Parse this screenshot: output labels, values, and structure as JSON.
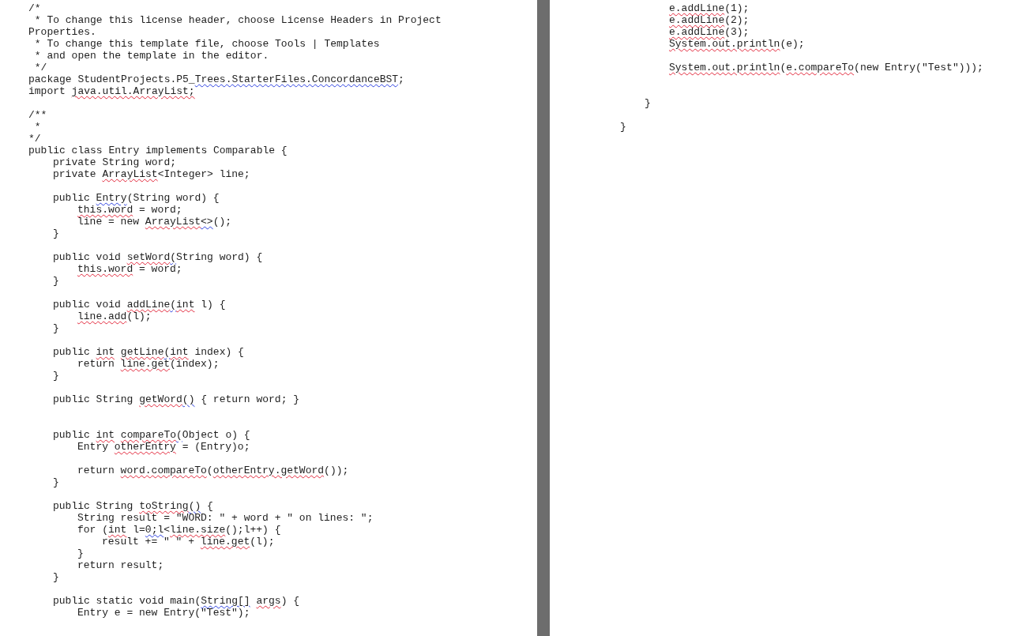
{
  "pages": [
    {
      "lines": [
        {
          "kind": "code",
          "segments": [
            {
              "text": "/*"
            }
          ]
        },
        {
          "kind": "code",
          "segments": [
            {
              "text": " * To change this license header, choose License Headers in Project"
            }
          ]
        },
        {
          "kind": "code",
          "segments": [
            {
              "text": "Properties."
            }
          ]
        },
        {
          "kind": "code",
          "segments": [
            {
              "text": " * To change this template file, choose Tools | Templates"
            }
          ]
        },
        {
          "kind": "code",
          "segments": [
            {
              "text": " * and open the template in the editor."
            }
          ]
        },
        {
          "kind": "code",
          "segments": [
            {
              "text": " */"
            }
          ]
        },
        {
          "kind": "code",
          "segments": [
            {
              "text": "package StudentProjects.P5_"
            },
            {
              "text": "Trees.StarterFiles.ConcordanceBST",
              "grammar_error": true
            },
            {
              "text": ";"
            }
          ]
        },
        {
          "kind": "code",
          "segments": [
            {
              "text": "import "
            },
            {
              "text": "java.util.ArrayList;",
              "spelling_error": true
            }
          ]
        },
        {
          "kind": "blank"
        },
        {
          "kind": "code",
          "segments": [
            {
              "text": "/**"
            }
          ]
        },
        {
          "kind": "code",
          "segments": [
            {
              "text": " *"
            }
          ]
        },
        {
          "kind": "code",
          "segments": [
            {
              "text": "*/"
            }
          ]
        },
        {
          "kind": "code",
          "segments": [
            {
              "text": "public class Entry implements Comparable {"
            }
          ],
          "children": [
            {
              "kind": "code",
              "segments": [
                {
                  "text": "private String word;"
                }
              ]
            },
            {
              "kind": "code",
              "segments": [
                {
                  "text": "private "
                },
                {
                  "text": "ArrayList",
                  "spelling_error": true
                },
                {
                  "text": "<Integer> line;"
                }
              ]
            },
            {
              "kind": "blank"
            },
            {
              "kind": "code",
              "segments": [
                {
                  "text": "public "
                },
                {
                  "text": "Entry",
                  "grammar_error": true
                },
                {
                  "text": "(String word) {"
                }
              ],
              "children": [
                {
                  "kind": "code",
                  "segments": [
                    {
                      "text": "this.word",
                      "spelling_error": true
                    },
                    {
                      "text": " = word;"
                    }
                  ]
                },
                {
                  "kind": "code",
                  "segments": [
                    {
                      "text": "line = new "
                    },
                    {
                      "text": "ArrayList",
                      "spelling_error": true
                    },
                    {
                      "text": "<>",
                      "grammar_error": true
                    },
                    {
                      "text": "();"
                    }
                  ]
                }
              ]
            },
            {
              "kind": "code",
              "segments": [
                {
                  "text": "}"
                }
              ]
            },
            {
              "kind": "blank"
            },
            {
              "kind": "code",
              "segments": [
                {
                  "text": "public void "
                },
                {
                  "text": "setWord",
                  "spelling_error": true
                },
                {
                  "text": "(",
                  "grammar_error": true
                },
                {
                  "text": "String word) {"
                }
              ],
              "children": [
                {
                  "kind": "code",
                  "segments": [
                    {
                      "text": "this.word",
                      "spelling_error": true
                    },
                    {
                      "text": " = word;"
                    }
                  ]
                }
              ]
            },
            {
              "kind": "code",
              "segments": [
                {
                  "text": "}"
                }
              ]
            },
            {
              "kind": "blank"
            },
            {
              "kind": "code",
              "segments": [
                {
                  "text": "public void "
                },
                {
                  "text": "addLine",
                  "spelling_error": true
                },
                {
                  "text": "(",
                  "grammar_error": true
                },
                {
                  "text": "int",
                  "spelling_error": true
                },
                {
                  "text": " l) {"
                }
              ],
              "children": [
                {
                  "kind": "code",
                  "segments": [
                    {
                      "text": "line.add",
                      "spelling_error": true
                    },
                    {
                      "text": "(l);"
                    }
                  ]
                }
              ]
            },
            {
              "kind": "code",
              "segments": [
                {
                  "text": "}"
                }
              ]
            },
            {
              "kind": "blank"
            },
            {
              "kind": "code",
              "segments": [
                {
                  "text": "public "
                },
                {
                  "text": "int",
                  "spelling_error": true
                },
                {
                  "text": " getLine",
                  "spelling_error": true
                },
                {
                  "text": "(",
                  "grammar_error": true
                },
                {
                  "text": "int",
                  "spelling_error": true
                },
                {
                  "text": " index) {"
                }
              ],
              "children": [
                {
                  "kind": "code",
                  "segments": [
                    {
                      "text": "return "
                    },
                    {
                      "text": "line.get",
                      "spelling_error": true
                    },
                    {
                      "text": "(index);"
                    }
                  ]
                }
              ]
            },
            {
              "kind": "code",
              "segments": [
                {
                  "text": "}"
                }
              ]
            },
            {
              "kind": "blank"
            },
            {
              "kind": "code",
              "segments": [
                {
                  "text": "public String "
                },
                {
                  "text": "getWord",
                  "spelling_error": true
                },
                {
                  "text": "()",
                  "grammar_error": true
                },
                {
                  "text": " { return word; }"
                }
              ]
            },
            {
              "kind": "blank"
            },
            {
              "kind": "blank"
            },
            {
              "kind": "code",
              "segments": [
                {
                  "text": "public "
                },
                {
                  "text": "int",
                  "spelling_error": true
                },
                {
                  "text": " compareTo",
                  "spelling_error": true
                },
                {
                  "text": "(",
                  "grammar_error": true
                },
                {
                  "text": "Object o) {"
                }
              ],
              "children": [
                {
                  "kind": "code",
                  "segments": [
                    {
                      "text": "Entry "
                    },
                    {
                      "text": "otherEntry",
                      "spelling_error": true
                    },
                    {
                      "text": " = (Entry)o;"
                    }
                  ]
                },
                {
                  "kind": "blank"
                },
                {
                  "kind": "code",
                  "segments": [
                    {
                      "text": "return "
                    },
                    {
                      "text": "word.compareTo",
                      "spelling_error": true
                    },
                    {
                      "text": "("
                    },
                    {
                      "text": "otherEntry.getWord",
                      "spelling_error": true
                    },
                    {
                      "text": "());"
                    }
                  ]
                }
              ]
            },
            {
              "kind": "code",
              "segments": [
                {
                  "text": "}"
                }
              ]
            },
            {
              "kind": "blank"
            },
            {
              "kind": "code",
              "segments": [
                {
                  "text": "public String "
                },
                {
                  "text": "toString",
                  "spelling_error": true
                },
                {
                  "text": "()",
                  "grammar_error": true
                },
                {
                  "text": " {"
                }
              ],
              "children": [
                {
                  "kind": "code",
                  "segments": [
                    {
                      "text": "String result = \"WORD: \" + word + \" on lines: \";"
                    }
                  ]
                },
                {
                  "kind": "code",
                  "segments": [
                    {
                      "text": "for ("
                    },
                    {
                      "text": "int",
                      "spelling_error": true
                    },
                    {
                      "text": " l="
                    },
                    {
                      "text": "0;l",
                      "grammar_error": true
                    },
                    {
                      "text": "<"
                    },
                    {
                      "text": "line.size",
                      "spelling_error": true
                    },
                    {
                      "text": "();l++) {"
                    }
                  ],
                  "children": [
                    {
                      "kind": "code",
                      "segments": [
                        {
                          "text": "result += \" \" + "
                        },
                        {
                          "text": "line.get",
                          "spelling_error": true
                        },
                        {
                          "text": "(l);"
                        }
                      ]
                    }
                  ]
                },
                {
                  "kind": "code",
                  "segments": [
                    {
                      "text": "}"
                    }
                  ]
                },
                {
                  "kind": "code",
                  "segments": [
                    {
                      "text": "return result;"
                    }
                  ]
                }
              ]
            },
            {
              "kind": "code",
              "segments": [
                {
                  "text": "}"
                }
              ]
            },
            {
              "kind": "blank"
            },
            {
              "kind": "code",
              "segments": [
                {
                  "text": "public static void main("
                },
                {
                  "text": "String[]",
                  "grammar_error": true
                },
                {
                  "text": " args",
                  "spelling_error": true
                },
                {
                  "text": ") {"
                }
              ],
              "children": [
                {
                  "kind": "code",
                  "segments": [
                    {
                      "text": "Entry e = new Entry(\"Test\");"
                    }
                  ]
                }
              ]
            }
          ]
        }
      ]
    },
    {
      "lines": [
        {
          "kind": "continued",
          "children": [
            {
              "kind": "continued",
              "children": [
                {
                  "kind": "code",
                  "segments": [
                    {
                      "text": "e.addLine",
                      "spelling_error": true
                    },
                    {
                      "text": "(1);"
                    }
                  ]
                },
                {
                  "kind": "code",
                  "segments": [
                    {
                      "text": "e.addLine",
                      "spelling_error": true
                    },
                    {
                      "text": "(2);"
                    }
                  ]
                },
                {
                  "kind": "code",
                  "segments": [
                    {
                      "text": "e.addLine",
                      "spelling_error": true
                    },
                    {
                      "text": "(3);"
                    }
                  ]
                },
                {
                  "kind": "code",
                  "segments": [
                    {
                      "text": "System.out.println",
                      "spelling_error": true
                    },
                    {
                      "text": "(e);"
                    }
                  ]
                },
                {
                  "kind": "blank"
                },
                {
                  "kind": "code",
                  "segments": [
                    {
                      "text": "System.out.println",
                      "spelling_error": true
                    },
                    {
                      "text": "("
                    },
                    {
                      "text": "e.compareTo",
                      "spelling_error": true
                    },
                    {
                      "text": "(new Entry(\"Test\")));"
                    }
                  ]
                },
                {
                  "kind": "blank"
                },
                {
                  "kind": "blank"
                }
              ]
            },
            {
              "kind": "code",
              "segments": [
                {
                  "text": "}"
                }
              ]
            },
            {
              "kind": "blank"
            }
          ]
        },
        {
          "kind": "code",
          "segments": [
            {
              "text": "}"
            }
          ]
        }
      ]
    }
  ]
}
